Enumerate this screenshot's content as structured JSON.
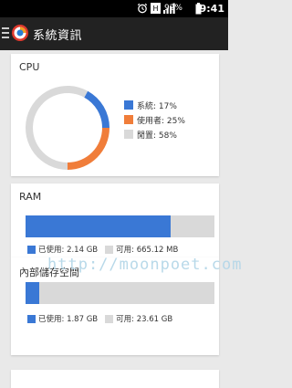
{
  "status_bar": {
    "battery_percent": "92%",
    "time": "9:41",
    "network_label": "H",
    "icons": [
      "alarm-icon",
      "wifi-icon",
      "signal-icon",
      "battery-icon"
    ]
  },
  "header": {
    "title": "系統資訊",
    "icons": [
      "menu-icon",
      "app-logo-icon"
    ]
  },
  "cpu": {
    "title": "CPU",
    "legend": [
      {
        "label": "系統: 17%",
        "color": "#3a78d5"
      },
      {
        "label": "使用者: 25%",
        "color": "#f07d3a"
      },
      {
        "label": "閒置: 58%",
        "color": "#d9d9d9"
      }
    ],
    "chart_data": {
      "type": "pie",
      "categories": [
        "系統",
        "使用者",
        "閒置"
      ],
      "values": [
        17,
        25,
        58
      ],
      "colors": [
        "#3a78d5",
        "#f07d3a",
        "#d9d9d9"
      ],
      "title": "",
      "legend_position": "right"
    }
  },
  "ram": {
    "title": "RAM",
    "used_label": "已使用: 2.14 GB",
    "free_label": "可用: 665.12 MB",
    "used_fraction": 0.77,
    "used_color": "#3a78d5",
    "free_color": "#d9d9d9"
  },
  "storage": {
    "title": "內部儲存空間",
    "used_label": "已使用: 1.87 GB",
    "free_label": "可用: 23.61 GB",
    "used_fraction": 0.073,
    "used_color": "#3a78d5",
    "free_color": "#d9d9d9"
  },
  "watermark": "http://moonpoet.com"
}
